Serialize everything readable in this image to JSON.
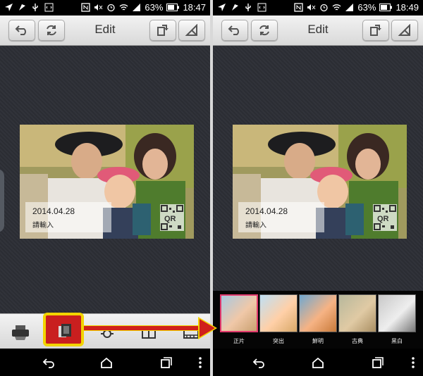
{
  "left": {
    "status": {
      "battery": "63%",
      "time": "18:47"
    },
    "header": {
      "title": "Edit"
    },
    "photo": {
      "date": "2014.04.28",
      "placeholder": "請輸入",
      "qr": "QR"
    }
  },
  "right": {
    "status": {
      "battery": "63%",
      "time": "18:49"
    },
    "header": {
      "title": "Edit"
    },
    "photo": {
      "date": "2014.04.28",
      "placeholder": "請輸入",
      "qr": "QR"
    },
    "filters": [
      {
        "label": "正片",
        "selected": true
      },
      {
        "label": "突出",
        "selected": false
      },
      {
        "label": "鮮明",
        "selected": false
      },
      {
        "label": "古典",
        "selected": false
      },
      {
        "label": "黑白",
        "selected": false
      }
    ]
  },
  "colors": {
    "highlight_border": "#f2d400",
    "highlight_fill": "#c91f1f",
    "arrow": "#d0211b",
    "selected_filter_border": "#e23a6e"
  },
  "icons": {
    "status_left": [
      "location-arrow-icon",
      "navigation-icon",
      "usb-icon",
      "code-icon"
    ],
    "status_right": [
      "nfc-icon",
      "mute-icon",
      "alarm-icon",
      "wifi-icon",
      "signal-icon",
      "battery-icon"
    ],
    "header_left": [
      "back-icon",
      "refresh-icon"
    ],
    "header_right": [
      "rotate-icon",
      "crop-icon"
    ],
    "toolbar": [
      "printer-icon",
      "frames-icon",
      "brightness-icon",
      "layout-icon",
      "film-icon"
    ],
    "navbar": [
      "nav-back-icon",
      "home-icon",
      "recent-apps-icon",
      "overflow-menu-icon"
    ]
  }
}
